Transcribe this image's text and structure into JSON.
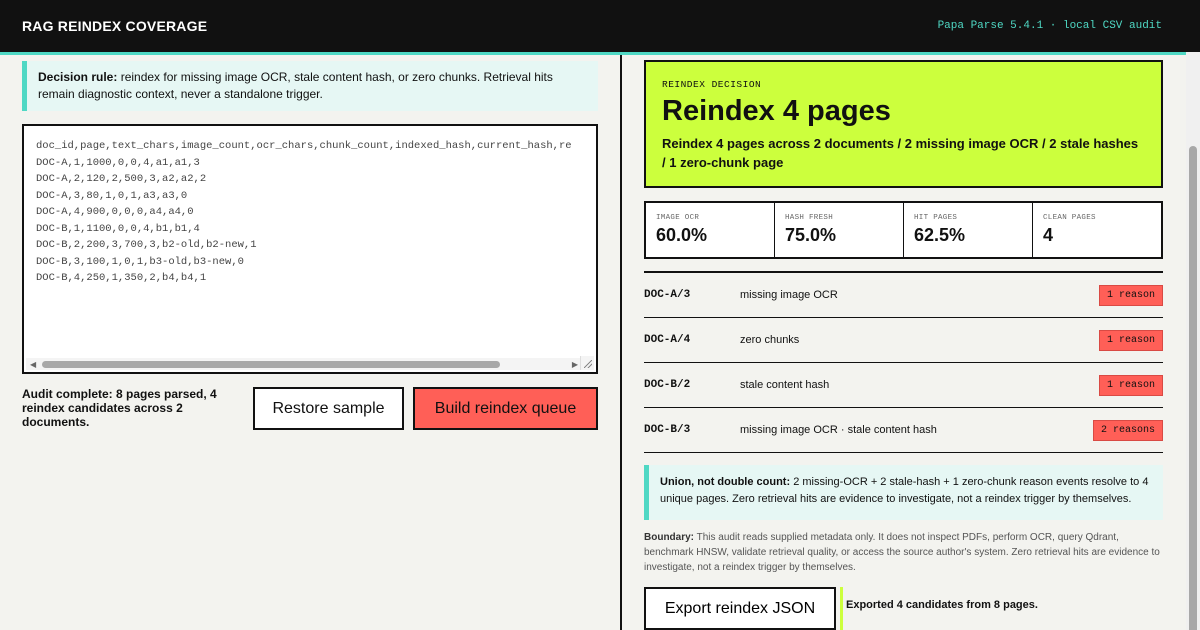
{
  "header": {
    "title": "RAG REINDEX COVERAGE",
    "meta": "Papa Parse 5.4.1 · local CSV audit"
  },
  "rule": {
    "label": "Decision rule:",
    "text": "reindex for missing image OCR, stale content hash, or zero chunks. Retrieval hits remain diagnostic context, never a standalone trigger."
  },
  "csv": {
    "value": "doc_id,page,text_chars,image_count,ocr_chars,chunk_count,indexed_hash,current_hash,re\nDOC-A,1,1000,0,0,4,a1,a1,3\nDOC-A,2,120,2,500,3,a2,a2,2\nDOC-A,3,80,1,0,1,a3,a3,0\nDOC-A,4,900,0,0,0,a4,a4,0\nDOC-B,1,1100,0,0,4,b1,b1,4\nDOC-B,2,200,3,700,3,b2-old,b2-new,1\nDOC-B,3,100,1,0,1,b3-old,b3-new,0\nDOC-B,4,250,1,350,2,b4,b4,1"
  },
  "status": "Audit complete: 8 pages parsed, 4 reindex candidates across 2 documents.",
  "buttons": {
    "restore": "Restore sample",
    "build": "Build reindex queue",
    "export": "Export reindex JSON"
  },
  "decision": {
    "kicker": "REINDEX DECISION",
    "headline": "Reindex 4 pages",
    "summary": "Reindex 4 pages across 2 documents / 2 missing image OCR / 2 stale hashes / 1 zero-chunk page"
  },
  "metrics": [
    {
      "label": "IMAGE OCR",
      "value": "60.0%"
    },
    {
      "label": "HASH FRESH",
      "value": "75.0%"
    },
    {
      "label": "HIT PAGES",
      "value": "62.5%"
    },
    {
      "label": "CLEAN PAGES",
      "value": "4"
    }
  ],
  "candidates": [
    {
      "id": "DOC-A/3",
      "reason": "missing image OCR",
      "badge": "1 reason"
    },
    {
      "id": "DOC-A/4",
      "reason": "zero chunks",
      "badge": "1 reason"
    },
    {
      "id": "DOC-B/2",
      "reason": "stale content hash",
      "badge": "1 reason"
    },
    {
      "id": "DOC-B/3",
      "reason": "missing image OCR · stale content hash",
      "badge": "2 reasons"
    }
  ],
  "union": {
    "label": "Union, not double count:",
    "text": "2 missing-OCR + 2 stale-hash + 1 zero-chunk reason events resolve to 4 unique pages. Zero retrieval hits are evidence to investigate, not a reindex trigger by themselves."
  },
  "boundary": {
    "label": "Boundary:",
    "text": "This audit reads supplied metadata only. It does not inspect PDFs, perform OCR, query Qdrant, benchmark HNSW, validate retrieval quality, or access the source author's system. Zero retrieval hits are evidence to investigate, not a reindex trigger by themselves."
  },
  "export_status": "Exported 4 candidates from 8 pages.",
  "colors": {
    "accent": "#4fd8c4",
    "decision_bg": "#ccff3d",
    "danger": "#ff5f57",
    "header_bg": "#111111"
  }
}
